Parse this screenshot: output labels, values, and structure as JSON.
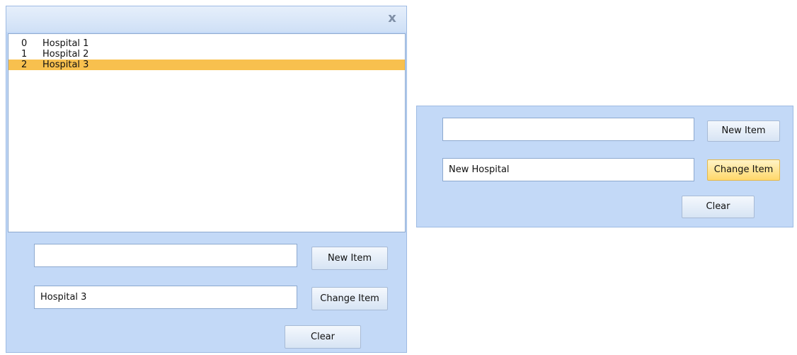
{
  "dialog": {
    "close_glyph": "x",
    "list_items": [
      {
        "index": "0",
        "name": "Hospital 1",
        "selected": false
      },
      {
        "index": "1",
        "name": "Hospital 2",
        "selected": false
      },
      {
        "index": "2",
        "name": "Hospital 3",
        "selected": true
      }
    ],
    "new_item_field": {
      "value": ""
    },
    "change_item_field": {
      "value": "Hospital 3"
    },
    "new_item_label": "New Item",
    "change_item_label": "Change Item",
    "clear_label": "Clear"
  },
  "panel": {
    "new_item_field": {
      "value": ""
    },
    "change_item_field": {
      "value": "New Hospital"
    },
    "new_item_label": "New Item",
    "change_item_label": "Change Item",
    "clear_label": "Clear"
  },
  "colors": {
    "dialog_bg": "#c3d9f7",
    "selection": "#f8c04e",
    "hover_button": "#ffd86b"
  }
}
